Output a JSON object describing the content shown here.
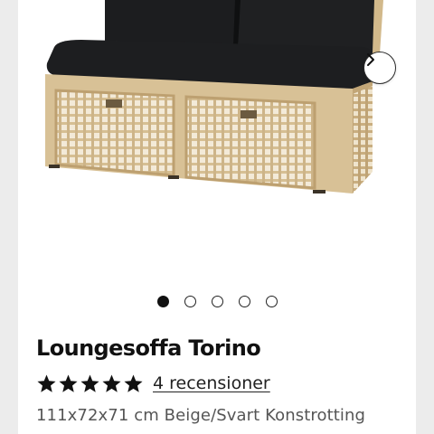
{
  "product": {
    "title": "Loungesoffa Torino",
    "rating_stars": 5,
    "reviews_link": "4 recensioner",
    "specs": "111x72x71 cm Beige/Svart Konstrotting"
  },
  "gallery": {
    "image_count": 5,
    "active_index": 0,
    "next_icon": "chevron-right-icon"
  },
  "colors": {
    "rattan": "#d9c39a",
    "rattan_dark": "#b79b6d",
    "cushion": "#1e1f21",
    "star": "#111111"
  }
}
